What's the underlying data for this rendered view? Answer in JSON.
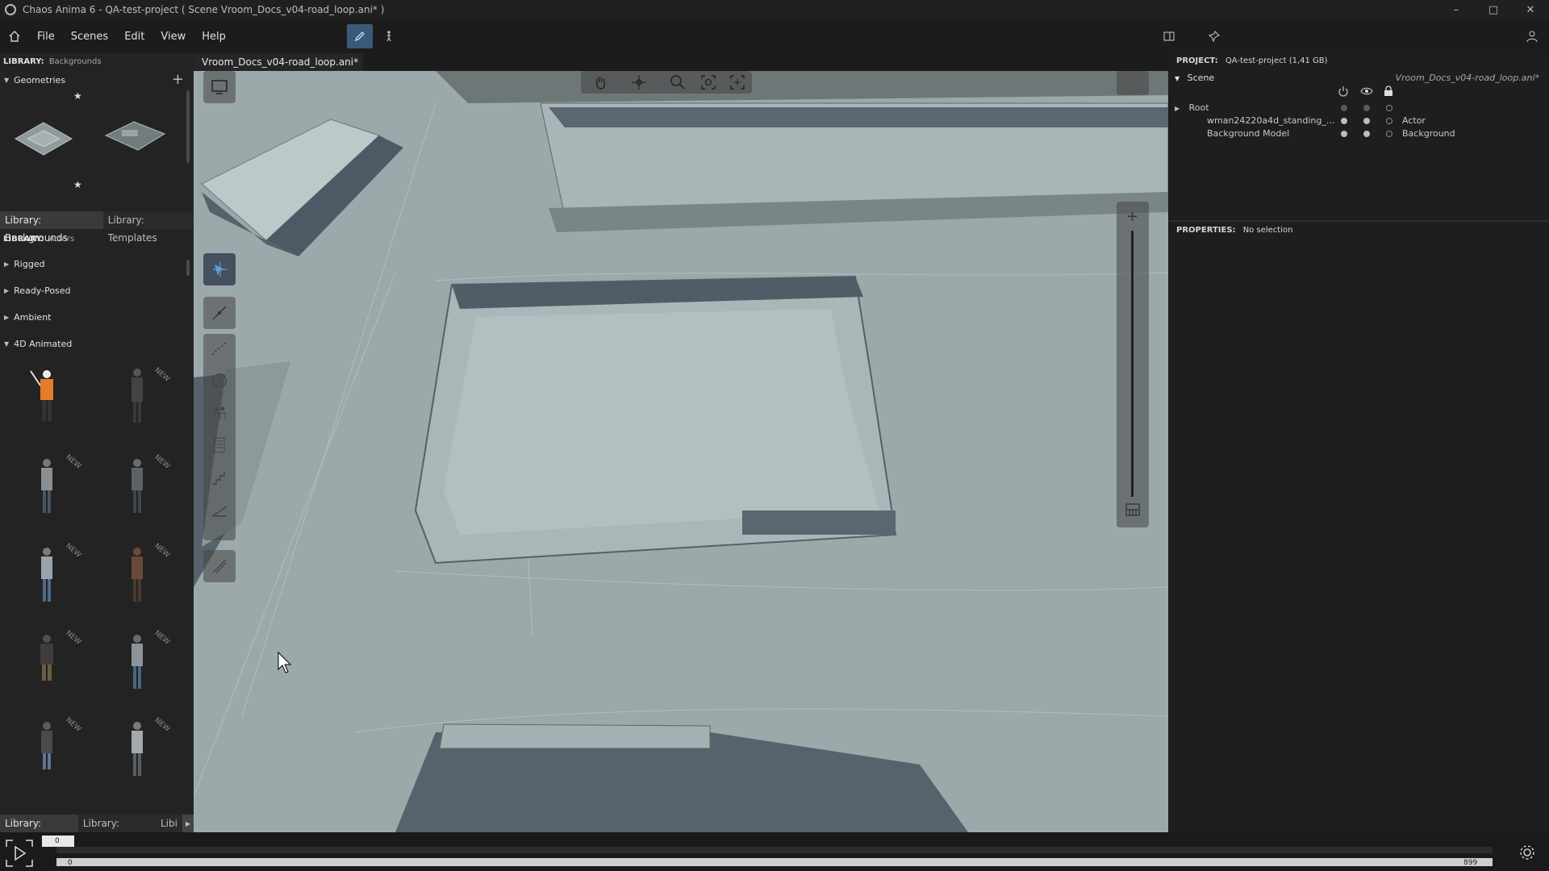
{
  "window": {
    "title": "Chaos Anima 6 -   QA-test-project ( Scene Vroom_Docs_v04-road_loop.ani* )",
    "controls": [
      "minimize-icon",
      "maximize-icon",
      "close-icon"
    ]
  },
  "menu": {
    "items": [
      "File",
      "Scenes",
      "Edit",
      "View",
      "Help"
    ]
  },
  "left_panel": {
    "top_library": {
      "label": "LIBRARY:",
      "name": "Backgrounds",
      "section": "Geometries"
    },
    "top_tabs": [
      "Library: Backgrounds",
      "Library: Templates"
    ],
    "actors_library": {
      "label": "LIBRARY:",
      "name": "Actors",
      "sections": [
        "Rigged",
        "Ready-Posed",
        "Ambient",
        "4D Animated"
      ],
      "new_tag": "NEW"
    },
    "bottom_tabs": [
      "Library: Actors",
      "Library: Vehi...",
      "Libi"
    ]
  },
  "doc_tab": "Vroom_Docs_v04-road_loop.ani*",
  "right_panel": {
    "project_label": "PROJECT:",
    "project_value": "QA-test-project (1,41 GB)",
    "scene_label": "Scene",
    "scene_file": "Vroom_Docs_v04-road_loop.ani*",
    "tree": [
      {
        "name": "Root",
        "type": ""
      },
      {
        "name": "wman24220a4d_standing_...",
        "type": "Actor"
      },
      {
        "name": "Background Model",
        "type": "Background"
      }
    ],
    "properties_label": "PROPERTIES:",
    "properties_value": "No selection"
  },
  "timeline": {
    "start": "0",
    "current": "0",
    "end": "899"
  },
  "colors": {
    "accent": "#3b5a7a",
    "viewport_ground": "#9aa8aa"
  }
}
